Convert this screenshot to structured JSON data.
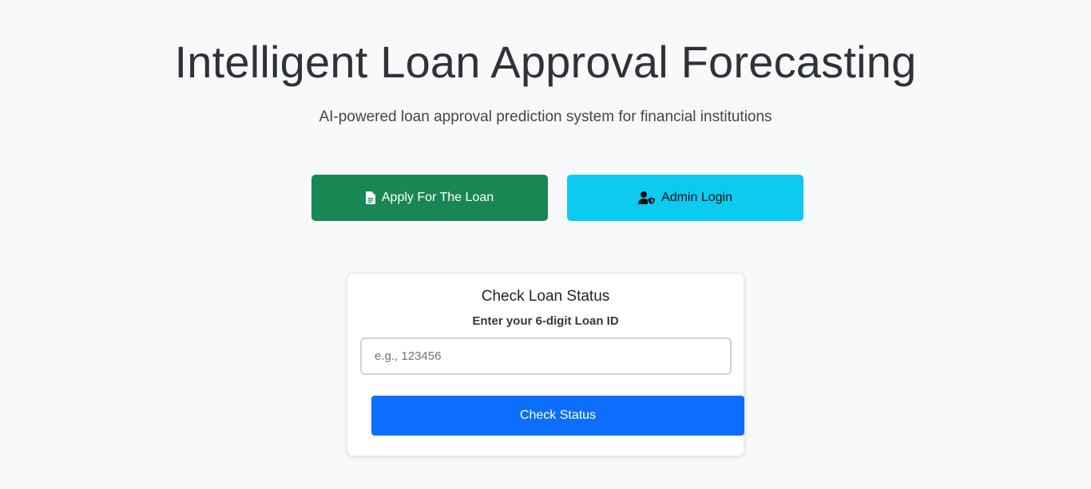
{
  "hero": {
    "title": "Intelligent Loan Approval Forecasting",
    "subtitle": "AI-powered loan approval prediction system for financial institutions"
  },
  "actions": {
    "apply_label": "Apply For The Loan",
    "apply_icon": "file-text-icon",
    "apply_color": "#198754",
    "admin_label": "Admin Login",
    "admin_icon": "user-shield-icon",
    "admin_color": "#0dcaf0"
  },
  "status_card": {
    "title": "Check Loan Status",
    "field_label": "Enter your 6-digit Loan ID",
    "input_value": "",
    "input_placeholder": "e.g., 123456",
    "submit_label": "Check Status",
    "submit_color": "#0d6efd"
  }
}
